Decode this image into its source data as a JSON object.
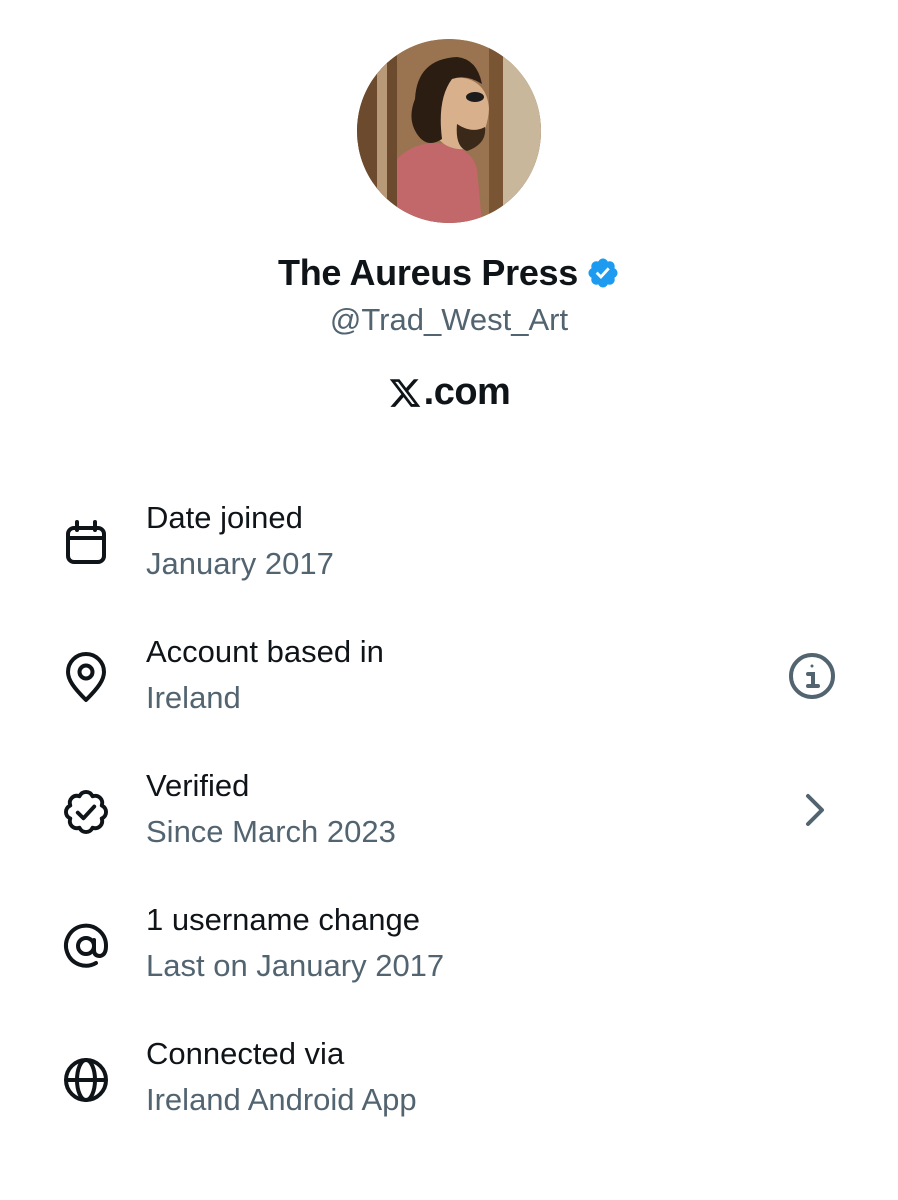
{
  "profile": {
    "display_name": "The Aureus Press",
    "handle": "@Trad_West_Art",
    "site": ".com"
  },
  "details": [
    {
      "icon": "calendar-icon",
      "label": "Date joined",
      "value": "January 2017"
    },
    {
      "icon": "location-pin-icon",
      "label": "Account based in",
      "value": "Ireland",
      "trailing": "info-icon"
    },
    {
      "icon": "verified-badge-icon",
      "label": "Verified",
      "value": "Since March 2023",
      "trailing": "chevron-right-icon"
    },
    {
      "icon": "at-sign-icon",
      "label": "1 username change",
      "value": "Last on January 2017"
    },
    {
      "icon": "globe-icon",
      "label": "Connected via",
      "value": "Ireland Android App"
    }
  ],
  "colors": {
    "text_primary": "#0f1419",
    "text_secondary": "#536471",
    "verified_blue": "#1d9bf0"
  }
}
